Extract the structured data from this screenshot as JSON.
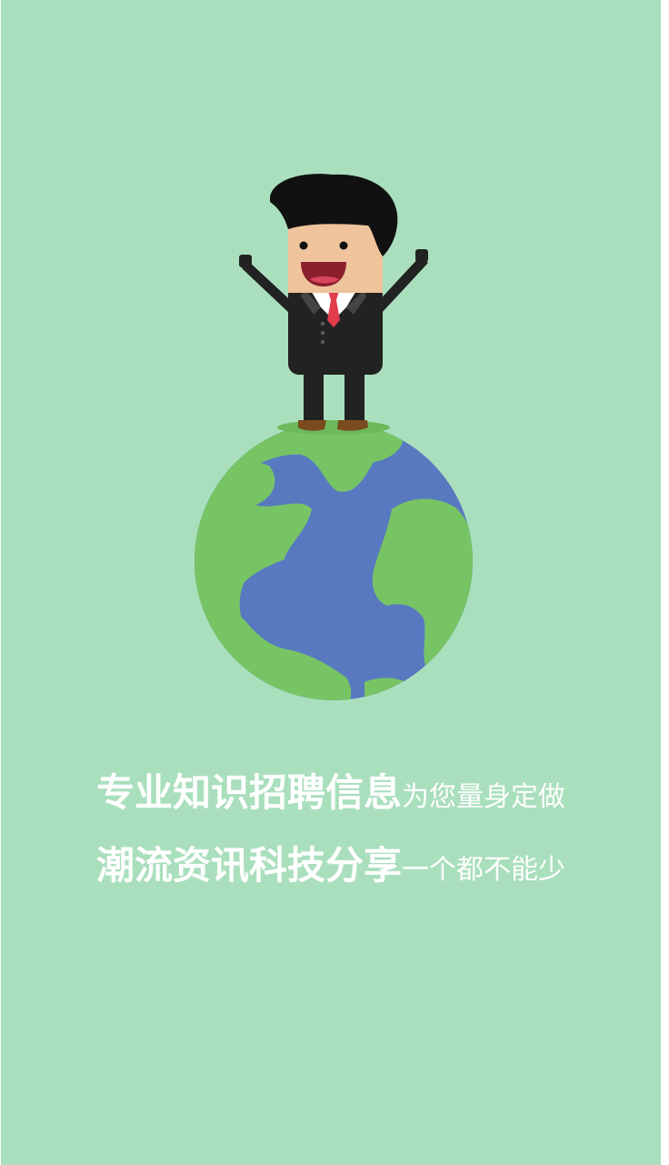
{
  "splash": {
    "line1": {
      "emphasis": "专业知识招聘信息",
      "rest": "为您量身定做"
    },
    "line2": {
      "emphasis": "潮流资讯科技分享",
      "rest": "一个都不能少"
    }
  },
  "icons": {
    "mascot": "businessman-icon",
    "globe": "globe-icon"
  },
  "colors": {
    "background": "#aadfbd",
    "ocean": "#5879c0",
    "land": "#77c465",
    "suit": "#222222",
    "skin": "#efc39b",
    "tie": "#e23b4a",
    "text": "#ffffff"
  }
}
